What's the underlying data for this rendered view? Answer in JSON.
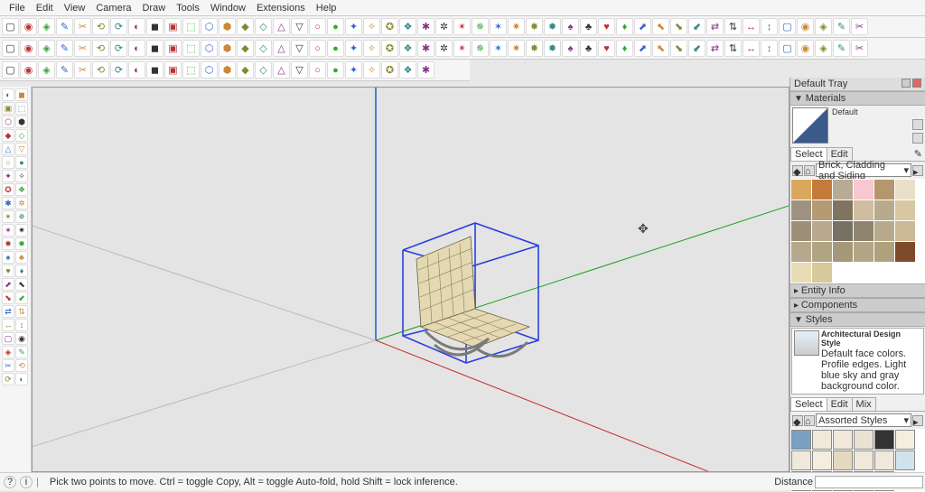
{
  "menu": [
    "File",
    "Edit",
    "View",
    "Camera",
    "Draw",
    "Tools",
    "Window",
    "Extensions",
    "Help"
  ],
  "status": {
    "hint": "Pick two points to move.  Ctrl = toggle Copy, Alt = toggle Auto-fold, hold Shift = lock inference.",
    "distance_label": "Distance"
  },
  "tray": {
    "title": "Default Tray",
    "materials": {
      "title": "Materials",
      "name": "Default",
      "tabs": [
        "Select",
        "Edit"
      ],
      "collection": "Brick, Cladding and Siding",
      "swatches": [
        "#d9a85e",
        "#c47b3a",
        "#b8ab93",
        "#f9c7d0",
        "#b5976d",
        "#e8e0c8",
        "#9e9281",
        "#b49b74",
        "#7f7460",
        "#cfbda0",
        "#b8aa8d",
        "#d8c7a3",
        "#9e8f78",
        "#b8a990",
        "#777065",
        "#8f846f",
        "#b7a98c",
        "#cbb895",
        "#b5a88c",
        "#b1a483",
        "#a59878",
        "#b3a585",
        "#b1a07c",
        "#7d4a2b",
        "#e6dcb6",
        "#d7c99a"
      ]
    },
    "entity_info": {
      "title": "Entity Info"
    },
    "components": {
      "title": "Components"
    },
    "styles": {
      "title": "Styles",
      "style_name": "Architectural Design Style",
      "style_desc": "Default face colors. Profile edges. Light blue sky and gray background color.",
      "tabs": [
        "Select",
        "Edit",
        "Mix"
      ],
      "collection": "Assorted Styles",
      "swatches": [
        "#7aa0c4",
        "#efe8db",
        "#efe8db",
        "#e9e2d2",
        "#333333",
        "#f5ede0",
        "#f0e9da",
        "#f5eee0",
        "#e4d9bc",
        "#efe8db",
        "#efe8db",
        "#cfe4ee",
        "#f0e8d8",
        "#efe8db",
        "#e8e0d0",
        "#efe8db",
        "#efe8db"
      ]
    }
  }
}
